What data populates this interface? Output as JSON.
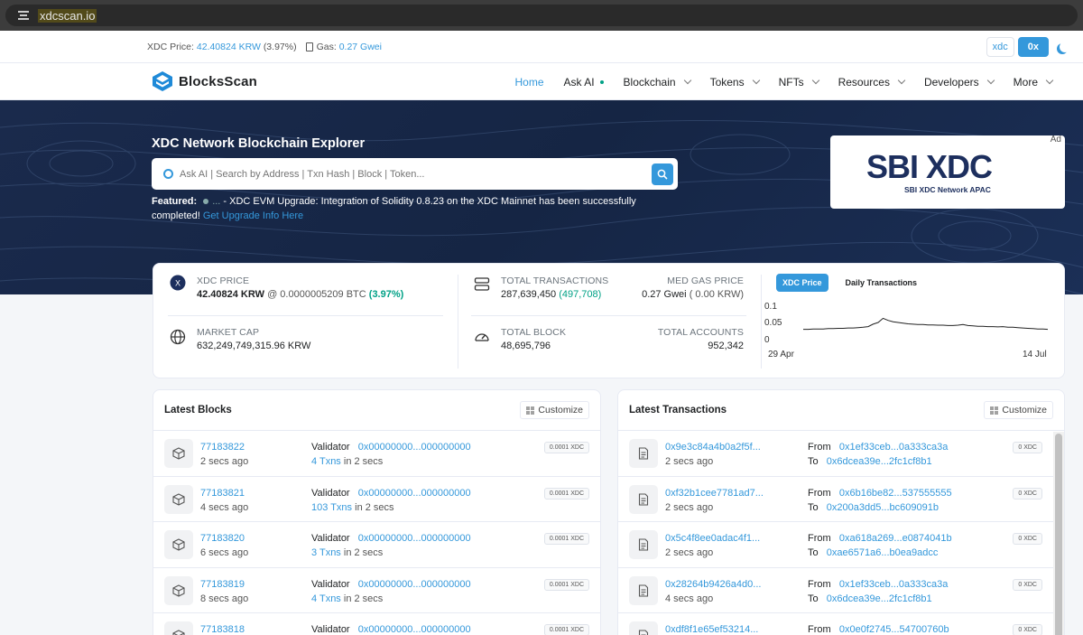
{
  "browser": {
    "url": "xdcscan.io"
  },
  "topbar": {
    "price_label": "XDC Price:",
    "price_value": "42.40824 KRW",
    "price_change": "(3.97%)",
    "gas_label": "Gas:",
    "gas_value": "0.27 Gwei",
    "prefix_options": [
      "xdc",
      "0x"
    ],
    "active_prefix": "0x"
  },
  "nav": {
    "brand": "BlocksScan",
    "items": [
      {
        "label": "Home",
        "active": true,
        "dropdown": false
      },
      {
        "label": "Ask AI",
        "active": false,
        "dropdown": false,
        "dot": true
      },
      {
        "label": "Blockchain",
        "active": false,
        "dropdown": true
      },
      {
        "label": "Tokens",
        "active": false,
        "dropdown": true
      },
      {
        "label": "NFTs",
        "active": false,
        "dropdown": true
      },
      {
        "label": "Resources",
        "active": false,
        "dropdown": true
      },
      {
        "label": "Developers",
        "active": false,
        "dropdown": true
      },
      {
        "label": "More",
        "active": false,
        "dropdown": true
      }
    ]
  },
  "hero": {
    "title": "XDC Network Blockchain Explorer",
    "search_placeholder": "Ask AI | Search by Address | Txn Hash | Block | Token...",
    "featured_label": "Featured:",
    "featured_text": " - XDC EVM Upgrade: Integration of Solidity 0.8.23 on the XDC Mainnet has been successfully completed!",
    "featured_link": "Get Upgrade Info Here",
    "ad_label": "Ad",
    "ad_brand": "SBI XDC",
    "ad_sub": "SBI XDC Network APAC"
  },
  "stats": {
    "xdc_price_label": "XDC PRICE",
    "xdc_price": "42.40824 KRW",
    "xdc_price_btc": "@ 0.0000005209 BTC",
    "xdc_price_change": "(3.97%)",
    "market_cap_label": "MARKET CAP",
    "market_cap": "632,249,749,315.96 KRW",
    "total_tx_label": "TOTAL TRANSACTIONS",
    "total_tx": "287,639,450",
    "total_tx_delta": "(497,708)",
    "med_gas_label": "MED GAS PRICE",
    "med_gas": "0.27 Gwei",
    "med_gas_krw": "( 0.00 KRW)",
    "total_block_label": "TOTAL BLOCK",
    "total_block": "48,695,796",
    "total_accounts_label": "TOTAL ACCOUNTS",
    "total_accounts": "952,342",
    "chart_tabs": [
      "XDC Price",
      "Daily Transactions"
    ],
    "active_chart_tab": "XDC Price"
  },
  "chart_data": {
    "type": "line",
    "x_labels": [
      "29 Apr",
      "14 Jul"
    ],
    "y_ticks": [
      "0.1",
      "0.05",
      "0"
    ],
    "ylim": [
      0,
      0.1
    ],
    "values": [
      0.03,
      0.03,
      0.031,
      0.031,
      0.031,
      0.032,
      0.032,
      0.033,
      0.033,
      0.034,
      0.034,
      0.035,
      0.036,
      0.038,
      0.045,
      0.05,
      0.062,
      0.056,
      0.052,
      0.05,
      0.048,
      0.046,
      0.045,
      0.044,
      0.044,
      0.043,
      0.043,
      0.042,
      0.042,
      0.041,
      0.041,
      0.042,
      0.044,
      0.041,
      0.04,
      0.039,
      0.039,
      0.038,
      0.038,
      0.037,
      0.038,
      0.036,
      0.036,
      0.035,
      0.034,
      0.033,
      0.032,
      0.031,
      0.031,
      0.03
    ]
  },
  "blocks": {
    "title": "Latest Blocks",
    "customize": "Customize",
    "validator_label": "Validator",
    "rows": [
      {
        "number": "77183822",
        "age": "2 secs ago",
        "validator": "0x00000000...000000000",
        "txns": "4 Txns",
        "time": "in 2 secs",
        "reward": "0.0001 XDC"
      },
      {
        "number": "77183821",
        "age": "4 secs ago",
        "validator": "0x00000000...000000000",
        "txns": "103 Txns",
        "time": "in 2 secs",
        "reward": "0.0001 XDC"
      },
      {
        "number": "77183820",
        "age": "6 secs ago",
        "validator": "0x00000000...000000000",
        "txns": "3 Txns",
        "time": "in 2 secs",
        "reward": "0.0001 XDC"
      },
      {
        "number": "77183819",
        "age": "8 secs ago",
        "validator": "0x00000000...000000000",
        "txns": "4 Txns",
        "time": "in 2 secs",
        "reward": "0.0001 XDC"
      },
      {
        "number": "77183818",
        "age": "",
        "validator": "0x00000000...000000000",
        "txns": "",
        "time": "",
        "reward": "0.0001 XDC"
      }
    ]
  },
  "transactions": {
    "title": "Latest Transactions",
    "customize": "Customize",
    "from_label": "From",
    "to_label": "To",
    "rows": [
      {
        "hash": "0x9e3c84a4b0a2f5f...",
        "age": "2 secs ago",
        "from": "0x1ef33ceb...0a333ca3a",
        "to": "0x6dcea39e...2fc1cf8b1",
        "value": "0 XDC"
      },
      {
        "hash": "0xf32b1cee7781ad7...",
        "age": "2 secs ago",
        "from": "0x6b16be82...537555555",
        "to": "0x200a3dd5...bc609091b",
        "value": "0 XDC"
      },
      {
        "hash": "0x5c4f8ee0adac4f1...",
        "age": "2 secs ago",
        "from": "0xa618a269...e0874041b",
        "to": "0xae6571a6...b0ea9adcc",
        "value": "0 XDC"
      },
      {
        "hash": "0x28264b9426a4d0...",
        "age": "4 secs ago",
        "from": "0x1ef33ceb...0a333ca3a",
        "to": "0x6dcea39e...2fc1cf8b1",
        "value": "0 XDC"
      },
      {
        "hash": "0xdf8f1e65ef53214...",
        "age": "",
        "from": "0x0e0f2745...54700760b",
        "to": "",
        "value": "0 XDC"
      }
    ]
  }
}
